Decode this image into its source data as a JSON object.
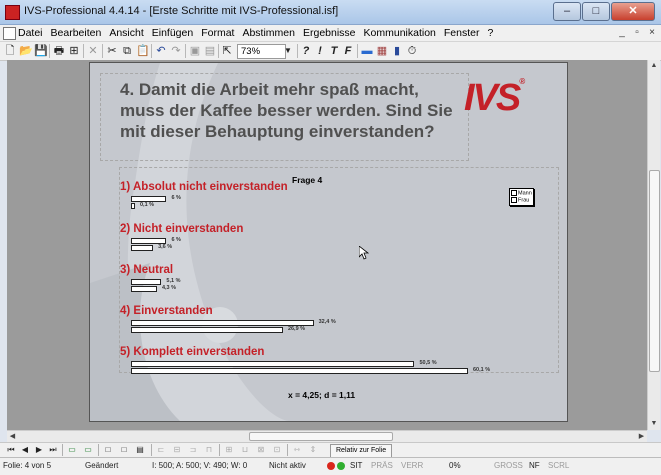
{
  "window": {
    "title": "IVS-Professional 4.4.14 - [Erste Schritte mit IVS-Professional.isf]",
    "buttons": {
      "minimize": "–",
      "maximize": "□",
      "close": "✕"
    }
  },
  "menubar": {
    "items": [
      "Datei",
      "Bearbeiten",
      "Ansicht",
      "Einfügen",
      "Format",
      "Abstimmen",
      "Ergebnisse",
      "Kommunikation",
      "Fenster",
      "?"
    ],
    "mdi_buttons": [
      "_",
      "▫",
      "×"
    ]
  },
  "toolbar": {
    "zoom": "73%",
    "format_labels": [
      "?",
      "!",
      "T",
      "F"
    ]
  },
  "slide": {
    "question": "4. Damit die Arbeit mehr spaß macht, muss der Kaffee besser werden. Sind Sie mit dieser Behauptung einverstanden?",
    "logo": "IVS",
    "logo_mark": "®",
    "stats": "x = 4,25; d = 1,11"
  },
  "chart_data": {
    "type": "bar",
    "title": "Frage 4",
    "categories": [
      "1) Absolut nicht einverstanden",
      "2) Nicht einverstanden",
      "3) Neutral",
      "4) Einverstanden",
      "5) Komplett einverstanden"
    ],
    "series": [
      {
        "name": "Mann",
        "values": [
          6,
          6,
          5.1,
          32.4,
          50.5
        ],
        "labels": [
          "6 %",
          "6 %",
          "5,1 %",
          "32,4 %",
          "50,5 %"
        ]
      },
      {
        "name": "Frau",
        "values": [
          0.1,
          3.6,
          4.3,
          26.9,
          60.1
        ],
        "labels": [
          "0,1 %",
          "3,6 %",
          "4,3 %",
          "26,9 %",
          "60,1 %"
        ]
      }
    ],
    "legend_placement": "right",
    "xlim": [
      0,
      60.1
    ]
  },
  "navbar": {
    "relative_label": "Relativ zur Folie"
  },
  "statusbar": {
    "slide_pos": "Folie: 4 von 5",
    "changed": "Geändert",
    "counts": "I: 500;  A: 500;  V: 490;  W: 0",
    "inactive": "Nicht aktiv",
    "sit": "SIT",
    "pras": "PRÄS",
    "verr": "VERR",
    "pct": "0%",
    "gross": "GROSS",
    "nf": "NF",
    "scrl": "SCRL",
    "colors": {
      "red": "#d9261c",
      "green": "#2fae2f"
    }
  }
}
